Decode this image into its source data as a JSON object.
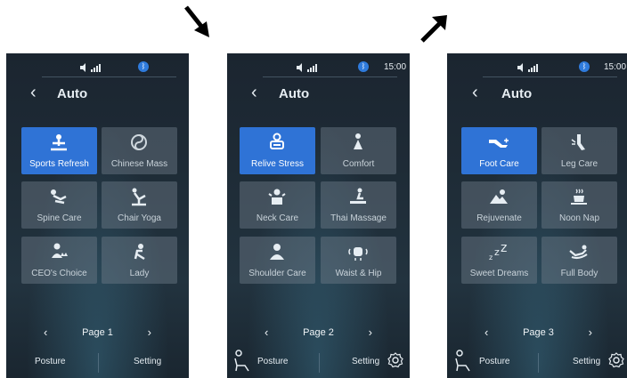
{
  "screens": [
    {
      "status": {
        "time": ""
      },
      "header": {
        "back": "‹",
        "title": "Auto"
      },
      "tiles": [
        {
          "label": "Sports Refresh",
          "icon": "sports-refresh-icon",
          "active": true
        },
        {
          "label": "Chinese Mass",
          "icon": "chinese-mass-icon",
          "active": false
        },
        {
          "label": "Spine Care",
          "icon": "spine-care-icon",
          "active": false
        },
        {
          "label": "Chair Yoga",
          "icon": "chair-yoga-icon",
          "active": false
        },
        {
          "label": "CEO's Choice",
          "icon": "ceo-choice-icon",
          "active": false
        },
        {
          "label": "Lady",
          "icon": "lady-icon",
          "active": false
        }
      ],
      "pager": {
        "prev": "‹",
        "text": "Page 1",
        "next": "›"
      },
      "bottom": {
        "posture": "Posture",
        "setting": "Setting"
      }
    },
    {
      "status": {
        "time": "15:00"
      },
      "header": {
        "back": "‹",
        "title": "Auto"
      },
      "tiles": [
        {
          "label": "Relive Stress",
          "icon": "relive-stress-icon",
          "active": true
        },
        {
          "label": "Comfort",
          "icon": "comfort-icon",
          "active": false
        },
        {
          "label": "Neck Care",
          "icon": "neck-care-icon",
          "active": false
        },
        {
          "label": "Thai Massage",
          "icon": "thai-massage-icon",
          "active": false
        },
        {
          "label": "Shoulder Care",
          "icon": "shoulder-care-icon",
          "active": false
        },
        {
          "label": "Waist & Hip",
          "icon": "waist-hip-icon",
          "active": false
        }
      ],
      "pager": {
        "prev": "‹",
        "text": "Page 2",
        "next": "›"
      },
      "bottom": {
        "posture": "Posture",
        "setting": "Setting"
      }
    },
    {
      "status": {
        "time": "15:00"
      },
      "header": {
        "back": "‹",
        "title": "Auto"
      },
      "tiles": [
        {
          "label": "Foot Care",
          "icon": "foot-care-icon",
          "active": true
        },
        {
          "label": "Leg Care",
          "icon": "leg-care-icon",
          "active": false
        },
        {
          "label": "Rejuvenate",
          "icon": "rejuvenate-icon",
          "active": false
        },
        {
          "label": "Noon Nap",
          "icon": "noon-nap-icon",
          "active": false
        },
        {
          "label": "Sweet Dreams",
          "icon": "sweet-dreams-icon",
          "active": false
        },
        {
          "label": "Full Body",
          "icon": "full-body-icon",
          "active": false
        }
      ],
      "pager": {
        "prev": "‹",
        "text": "Page 3",
        "next": "›"
      },
      "bottom": {
        "posture": "Posture",
        "setting": "Setting"
      }
    }
  ],
  "colors": {
    "accent": "#2f73d6",
    "tile": "#5c6a76",
    "background": "#1e2b36",
    "bluetooth": "#2f7bdc"
  }
}
